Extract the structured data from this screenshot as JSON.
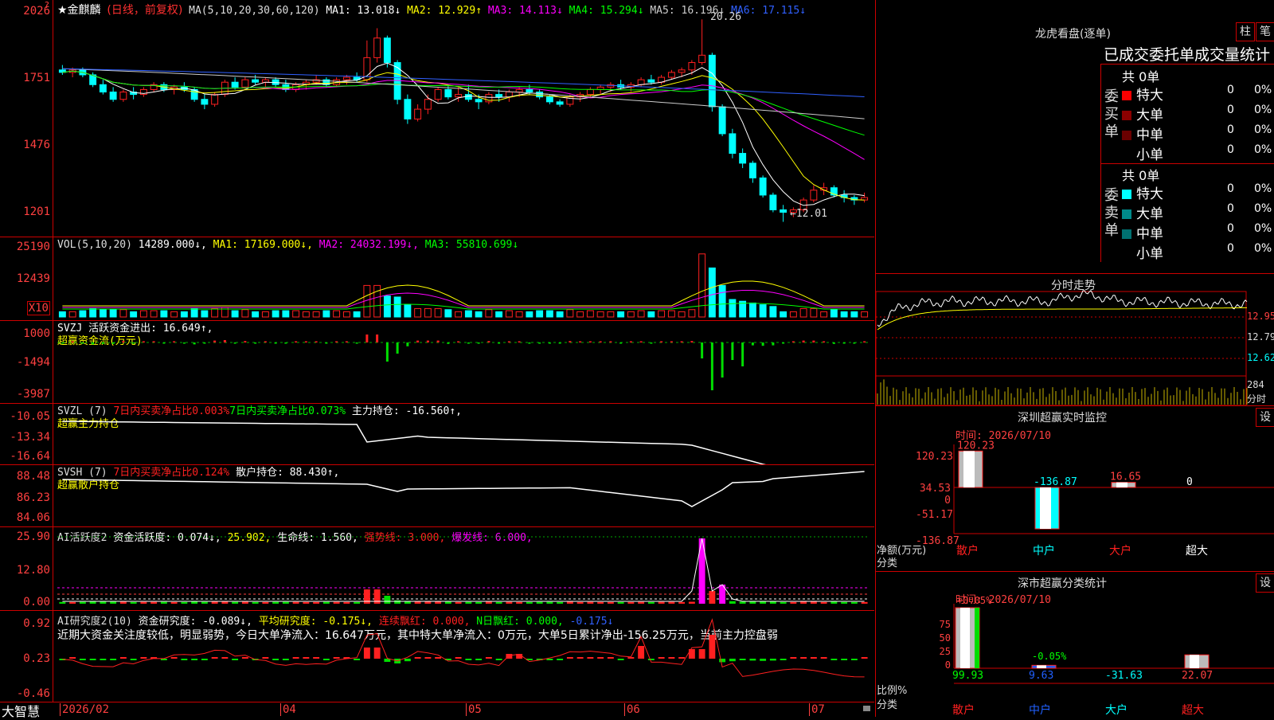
{
  "main": {
    "title": "★金麒麟",
    "mode": "(日线，前复权)",
    "ma_label": "MA(5,10,20,30,60,120)",
    "ma_items": [
      {
        "t": "MA1: 13.018↓",
        "c": "#ffffff"
      },
      {
        "t": "MA2: 12.929↑",
        "c": "#ffff00"
      },
      {
        "t": "MA3: 14.113↓",
        "c": "#ff00ff"
      },
      {
        "t": "MA4: 15.294↓",
        "c": "#00ff00"
      },
      {
        "t": "MA5: 16.196↓",
        "c": "#cccccc"
      },
      {
        "t": "MA6: 17.115↓",
        "c": "#3060ff"
      }
    ],
    "yticks": [
      "2026",
      "1751",
      "1476",
      "1201"
    ],
    "high_label": "20.26",
    "low_label": "←12.01",
    "help_mark": "?",
    "colors": {
      "up": "#ff2020",
      "down": "#00ffff",
      "ma1": "#ffffff",
      "ma2": "#ffff00",
      "ma3": "#ff00ff",
      "ma4": "#00ff00",
      "ma5": "#cccccc",
      "ma6": "#3060ff"
    }
  },
  "vol": {
    "label": "VOL(5,10,20)",
    "value": "14289.000↓,",
    "items": [
      {
        "t": "MA1: 17169.000↓,",
        "c": "#ffff00"
      },
      {
        "t": "MA2: 24032.199↓,",
        "c": "#ff00ff"
      },
      {
        "t": "MA3: 55810.699↓",
        "c": "#00ff00"
      }
    ],
    "yticks": [
      "25190",
      "12439"
    ],
    "unit": "X10"
  },
  "svzj": {
    "line1": "SVZJ  活跃资金进出: 16.649↑,",
    "line2": "超赢资金流(万元)",
    "yticks": [
      "1000",
      "-1494",
      "-3987"
    ]
  },
  "svzl": {
    "a": "SVZL (7)",
    "b": "7日内买卖净占比0.003%",
    "c": "7日内买卖净占比0.073%",
    "d": "主力持仓: -16.560↑,",
    "line2": "超赢主力持仓",
    "yticks": [
      "-10.05",
      "-13.34",
      "-16.64"
    ]
  },
  "svsh": {
    "a": "SVSH (7)",
    "b": "7日内买卖净占比0.124%",
    "d": "散户持仓: 88.430↑,",
    "line2": "超赢散户持仓",
    "yticks": [
      "88.48",
      "86.23",
      "84.06"
    ]
  },
  "ai1": {
    "a": "AI活跃度2",
    "b": "资金活跃度: 0.074↓,",
    "c": "25.902,",
    "d": "生命线: 1.560,",
    "e": "强势线: 3.000,",
    "f": "爆发线: 6.000,",
    "yticks": [
      "25.90",
      "12.80",
      "0.00"
    ]
  },
  "ai2": {
    "a": "AI研究度2(10)",
    "b": "资金研究度: -0.089↓,",
    "c": "平均研究度: -0.175↓,",
    "d": "连续飘红: 0.000,",
    "e": "N日飘红: 0.000,",
    "f": "-0.175↓",
    "comment": "近期大资金关注度较低，明显弱势，今日大单净流入：16.647万元，其中特大单净流入：0万元，大单5日累计净出-156.25万元，当前主力控盘弱",
    "yticks": [
      "0.92",
      "0.23",
      "-0.46"
    ]
  },
  "xaxis": {
    "brand": "大智慧",
    "labels": [
      "2026/02",
      "04",
      "05",
      "06",
      "07"
    ]
  },
  "dragon": {
    "title": "龙虎看盘(逐单)",
    "btn1": "柱",
    "btn2": "笔",
    "subtitle": "已成交委托单成交量统计",
    "buy_side": "委买单",
    "sell_side": "委卖单",
    "buy_total": "共 0单",
    "sell_total": "共 0单",
    "buy_rows": [
      {
        "label": "特大",
        "count": "0",
        "pct": "0%",
        "color": "#ff0000"
      },
      {
        "label": "大单",
        "count": "0",
        "pct": "0%",
        "color": "#8b0000"
      },
      {
        "label": "中单",
        "count": "0",
        "pct": "0%",
        "color": "#6a0000"
      },
      {
        "label": "小单",
        "count": "0",
        "pct": "0%",
        "color": ""
      }
    ],
    "sell_rows": [
      {
        "label": "特大",
        "count": "0",
        "pct": "0%",
        "color": "#00ffff"
      },
      {
        "label": "大单",
        "count": "0",
        "pct": "0%",
        "color": "#008b8b"
      },
      {
        "label": "中单",
        "count": "0",
        "pct": "0%",
        "color": "#007070"
      },
      {
        "label": "小单",
        "count": "0",
        "pct": "0%",
        "color": ""
      }
    ]
  },
  "intraday": {
    "title": "分时走势",
    "yticks": [
      "12.95",
      "12.79",
      "12.62"
    ],
    "vol_label": "284",
    "vol_unit": "分时"
  },
  "sz_monitor": {
    "title": "深圳超赢实时监控",
    "btn": "设",
    "time": "时间: 2026/07/10",
    "yticks": [
      "120.23",
      "34.53",
      "0",
      "-51.17",
      "-136.87"
    ],
    "ylabel": "净额(万元)",
    "xlabel": "分类",
    "categories": [
      "散户",
      "中户",
      "大户",
      "超大"
    ],
    "values_text": [
      "120.23",
      "-136.87",
      "16.65",
      "0"
    ],
    "cat_colors": [
      "#ff2020",
      "#00ffff",
      "#ff2020",
      "#ffffff"
    ]
  },
  "sz_classify": {
    "title": "深市超赢分类统计",
    "btn": "设",
    "time": "时间: 2026/07/10",
    "yticks": [
      "75",
      "50",
      "25",
      "0"
    ],
    "ylabel": "比例%",
    "xlabel": "分类",
    "top_labels": [
      "+0.05%",
      "-0.05%"
    ],
    "categories": [
      "散户",
      "中户",
      "大户",
      "超大"
    ],
    "values_text": [
      "99.93",
      "9.63",
      "-31.63",
      "22.07"
    ],
    "cat_colors": [
      "#ff2020",
      "#2060ff",
      "#00ffff",
      "#ff2020"
    ]
  },
  "chart_data": {
    "type": "candlestick",
    "dates_start": "2026/02",
    "ohlc": [
      [
        18.2,
        18.4,
        18.0,
        18.1
      ],
      [
        18.1,
        18.3,
        17.9,
        18.2
      ],
      [
        18.2,
        18.3,
        17.9,
        18.0
      ],
      [
        18.0,
        18.1,
        17.5,
        17.6
      ],
      [
        17.6,
        17.8,
        17.2,
        17.3
      ],
      [
        17.3,
        17.5,
        16.9,
        17.0
      ],
      [
        17.0,
        17.4,
        16.9,
        17.3
      ],
      [
        17.3,
        17.5,
        17.0,
        17.2
      ],
      [
        17.2,
        17.5,
        17.1,
        17.4
      ],
      [
        17.4,
        17.7,
        17.3,
        17.6
      ],
      [
        17.6,
        17.7,
        17.3,
        17.4
      ],
      [
        17.4,
        17.6,
        17.2,
        17.5
      ],
      [
        17.5,
        17.7,
        17.3,
        17.4
      ],
      [
        17.4,
        17.5,
        16.9,
        17.0
      ],
      [
        17.0,
        17.2,
        16.6,
        16.8
      ],
      [
        16.8,
        17.3,
        16.7,
        17.2
      ],
      [
        17.2,
        17.8,
        17.1,
        17.7
      ],
      [
        17.7,
        17.9,
        17.4,
        17.5
      ],
      [
        17.5,
        17.9,
        17.4,
        17.8
      ],
      [
        17.8,
        18.0,
        17.6,
        17.7
      ],
      [
        17.7,
        17.9,
        17.5,
        17.8
      ],
      [
        17.8,
        17.9,
        17.5,
        17.6
      ],
      [
        17.6,
        17.8,
        17.3,
        17.4
      ],
      [
        17.4,
        17.7,
        17.3,
        17.6
      ],
      [
        17.6,
        17.8,
        17.4,
        17.7
      ],
      [
        17.7,
        18.0,
        17.6,
        17.8
      ],
      [
        17.8,
        17.9,
        17.5,
        17.6
      ],
      [
        17.6,
        17.9,
        17.5,
        17.8
      ],
      [
        17.8,
        18.0,
        17.6,
        17.9
      ],
      [
        17.9,
        18.1,
        17.7,
        17.8
      ],
      [
        17.8,
        19.4,
        17.7,
        18.7
      ],
      [
        18.7,
        19.9,
        18.5,
        19.5
      ],
      [
        19.5,
        19.6,
        18.3,
        18.5
      ],
      [
        18.5,
        18.6,
        16.8,
        17.0
      ],
      [
        17.0,
        17.2,
        16.0,
        16.2
      ],
      [
        16.2,
        16.8,
        16.1,
        16.6
      ],
      [
        16.6,
        17.2,
        16.4,
        17.0
      ],
      [
        17.0,
        17.5,
        16.9,
        17.4
      ],
      [
        17.4,
        17.6,
        17.0,
        17.1
      ],
      [
        17.1,
        17.5,
        16.9,
        17.2
      ],
      [
        17.2,
        17.6,
        16.9,
        17.0
      ],
      [
        17.0,
        17.2,
        16.6,
        16.9
      ],
      [
        16.9,
        17.3,
        16.8,
        17.2
      ],
      [
        17.2,
        17.4,
        16.9,
        17.1
      ],
      [
        17.1,
        17.4,
        16.9,
        17.3
      ],
      [
        17.3,
        17.5,
        17.1,
        17.4
      ],
      [
        17.4,
        17.6,
        17.2,
        17.3
      ],
      [
        17.3,
        17.4,
        17.0,
        17.1
      ],
      [
        17.1,
        17.2,
        16.8,
        16.9
      ],
      [
        16.9,
        17.0,
        16.7,
        16.8
      ],
      [
        16.8,
        17.2,
        16.7,
        17.1
      ],
      [
        17.1,
        17.3,
        16.9,
        17.2
      ],
      [
        17.2,
        17.5,
        17.1,
        17.4
      ],
      [
        17.4,
        17.6,
        17.2,
        17.5
      ],
      [
        17.5,
        17.7,
        17.3,
        17.6
      ],
      [
        17.6,
        17.8,
        17.4,
        17.5
      ],
      [
        17.5,
        17.7,
        17.3,
        17.6
      ],
      [
        17.6,
        17.9,
        17.5,
        17.8
      ],
      [
        17.8,
        18.0,
        17.6,
        17.7
      ],
      [
        17.7,
        18.0,
        17.6,
        17.9
      ],
      [
        17.9,
        18.2,
        17.8,
        18.1
      ],
      [
        18.1,
        18.3,
        17.9,
        18.2
      ],
      [
        18.2,
        18.6,
        18.0,
        18.5
      ],
      [
        18.5,
        20.26,
        18.4,
        18.8
      ],
      [
        18.8,
        18.9,
        16.5,
        16.7
      ],
      [
        16.7,
        16.8,
        15.5,
        15.6
      ],
      [
        15.6,
        15.8,
        14.6,
        14.8
      ],
      [
        14.8,
        15.0,
        14.2,
        14.4
      ],
      [
        14.4,
        14.5,
        13.6,
        13.8
      ],
      [
        13.8,
        13.9,
        13.0,
        13.1
      ],
      [
        13.1,
        13.2,
        12.4,
        12.5
      ],
      [
        12.5,
        12.7,
        12.01,
        12.4
      ],
      [
        12.4,
        12.6,
        12.2,
        12.5
      ],
      [
        12.5,
        13.0,
        12.4,
        12.9
      ],
      [
        12.9,
        13.5,
        12.8,
        13.3
      ],
      [
        13.3,
        13.6,
        13.1,
        13.4
      ],
      [
        13.4,
        13.5,
        13.0,
        13.1
      ],
      [
        13.1,
        13.3,
        12.8,
        13.0
      ],
      [
        13.0,
        13.1,
        12.7,
        12.9
      ],
      [
        12.9,
        13.2,
        12.8,
        13.0
      ]
    ],
    "ylim": [
      11.8,
      20.4
    ]
  }
}
